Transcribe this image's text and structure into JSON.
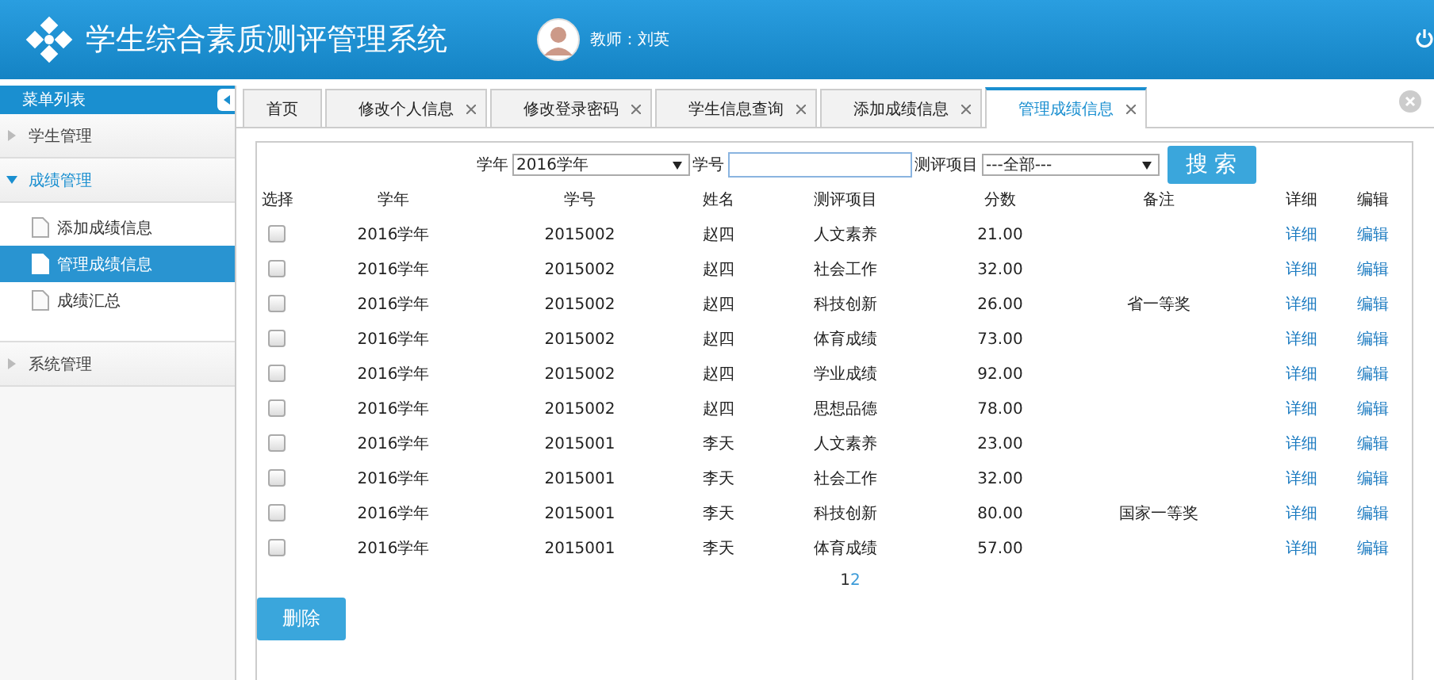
{
  "header": {
    "title": "学生综合素质测评管理系统",
    "user": "教师：刘英"
  },
  "sidebar": {
    "title": "菜单列表",
    "groups": [
      {
        "label": "学生管理",
        "expanded": false
      },
      {
        "label": "成绩管理",
        "expanded": true,
        "children": [
          {
            "label": "添加成绩信息",
            "selected": false
          },
          {
            "label": "管理成绩信息",
            "selected": true
          },
          {
            "label": "成绩汇总",
            "selected": false
          }
        ]
      },
      {
        "label": "系统管理",
        "expanded": false
      }
    ]
  },
  "tabs": [
    {
      "label": "首页",
      "selected": false,
      "closable": false
    },
    {
      "label": "修改个人信息",
      "selected": false,
      "closable": true
    },
    {
      "label": "修改登录密码",
      "selected": false,
      "closable": true
    },
    {
      "label": "学生信息查询",
      "selected": false,
      "closable": true
    },
    {
      "label": "添加成绩信息",
      "selected": false,
      "closable": true
    },
    {
      "label": "管理成绩信息",
      "selected": true,
      "closable": true
    }
  ],
  "filters": {
    "year_label": "学年",
    "year_value": "2016学年",
    "id_label": "学号",
    "item_label": "测评项目",
    "item_value": "---全部---",
    "search_button": "搜 索"
  },
  "table": {
    "columns": [
      "选择",
      "学年",
      "学号",
      "姓名",
      "测评项目",
      "分数",
      "备注",
      "详细",
      "编辑"
    ],
    "rows": [
      {
        "checked": false,
        "year": "2016学年",
        "id": "2015002",
        "name": "赵四",
        "item": "人文素养",
        "score": "21.00",
        "detail": "详细",
        "edit": "编辑"
      },
      {
        "checked": false,
        "year": "2016学年",
        "id": "2015002",
        "name": "赵四",
        "item": "社会工作",
        "score": "32.00",
        "detail": "详细",
        "edit": "编辑"
      },
      {
        "checked": false,
        "year": "2016学年",
        "id": "2015002",
        "name": "赵四",
        "item": "科技创新",
        "score": "26.00",
        "note": "省一等奖",
        "detail": "详细",
        "edit": "编辑"
      },
      {
        "checked": false,
        "year": "2016学年",
        "id": "2015002",
        "name": "赵四",
        "item": "体育成绩",
        "score": "73.00",
        "detail": "详细",
        "edit": "编辑"
      },
      {
        "checked": false,
        "year": "2016学年",
        "id": "2015002",
        "name": "赵四",
        "item": "学业成绩",
        "score": "92.00",
        "detail": "详细",
        "edit": "编辑"
      },
      {
        "checked": false,
        "year": "2016学年",
        "id": "2015002",
        "name": "赵四",
        "item": "思想品德",
        "score": "78.00",
        "detail": "详细",
        "edit": "编辑"
      },
      {
        "checked": false,
        "year": "2016学年",
        "id": "2015001",
        "name": "李天",
        "item": "人文素养",
        "score": "23.00",
        "detail": "详细",
        "edit": "编辑"
      },
      {
        "checked": false,
        "year": "2016学年",
        "id": "2015001",
        "name": "李天",
        "item": "社会工作",
        "score": "32.00",
        "detail": "详细",
        "edit": "编辑"
      },
      {
        "checked": false,
        "year": "2016学年",
        "id": "2015001",
        "name": "李天",
        "item": "科技创新",
        "score": "80.00",
        "note": "国家一等奖",
        "detail": "详细",
        "edit": "编辑"
      },
      {
        "checked": false,
        "year": "2016学年",
        "id": "2015001",
        "name": "李天",
        "item": "体育成绩",
        "score": "57.00",
        "detail": "详细",
        "edit": "编辑"
      }
    ]
  },
  "pagination": [
    {
      "label": "1",
      "selected": true
    },
    {
      "label": "2",
      "selected": false
    }
  ],
  "delete_button": "删除"
}
